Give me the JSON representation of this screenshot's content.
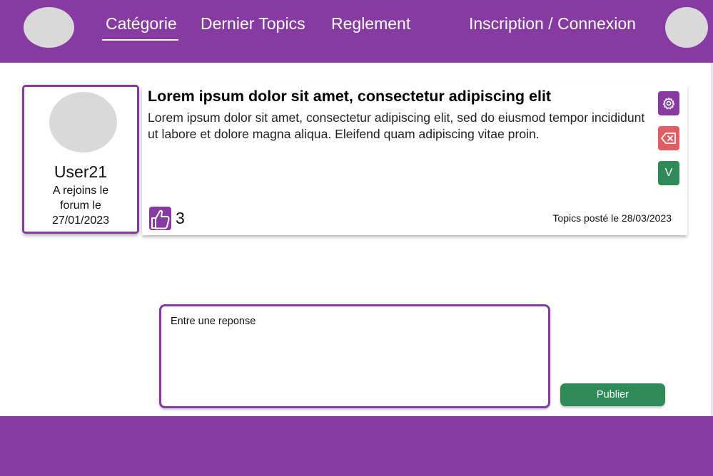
{
  "nav": {
    "categories": "Catégorie",
    "latest_topics": "Dernier Topics",
    "rules": "Reglement",
    "auth": "Inscription / Connexion"
  },
  "user": {
    "name": "User21",
    "joined": "A rejoins le forum le 27/01/2023"
  },
  "post": {
    "title": "Lorem ipsum dolor sit amet, consectetur adipiscing elit",
    "body": "Lorem ipsum dolor sit amet, consectetur adipiscing elit, sed do eiusmod tempor incididunt ut labore et dolore magna aliqua. Eleifend quam adipiscing vitae proin.",
    "likes": "3",
    "date": "Topics posté le 28/03/2023"
  },
  "actions": {
    "validate_label": "V",
    "settings_icon": "gear-icon",
    "delete_icon": "backspace-icon",
    "like_icon": "thumbs-up-icon"
  },
  "reply": {
    "placeholder": "Entre une reponse",
    "value": "",
    "publish_label": "Publier"
  },
  "colors": {
    "brand": "#873ba2",
    "success": "#2e8b57",
    "danger": "#e05d61",
    "placeholder_gray": "#d9d9d9"
  }
}
